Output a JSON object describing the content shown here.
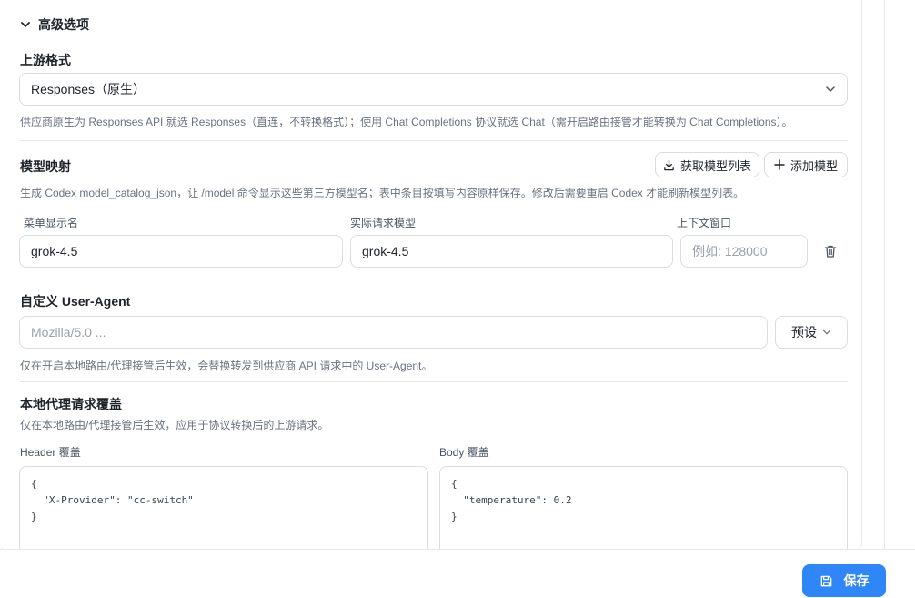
{
  "advanced": {
    "title": "高级选项"
  },
  "upstream_format": {
    "label": "上游格式",
    "value": "Responses（原生）",
    "hint": "供应商原生为 Responses API 就选 Responses（直连，不转换格式）；使用 Chat Completions 协议就选 Chat（需开启路由接管才能转换为 Chat Completions）。"
  },
  "model_mapping": {
    "label": "模型映射",
    "fetch_button": "获取模型列表",
    "add_button": "添加模型",
    "hint": "生成 Codex model_catalog_json，让 /model 命令显示这些第三方模型名；表中条目按填写内容原样保存。修改后需要重启 Codex 才能刷新模型列表。",
    "columns": [
      "菜单显示名",
      "实际请求模型",
      "上下文窗口"
    ],
    "rows": [
      {
        "display_name": "grok-4.5",
        "request_model": "grok-4.5",
        "context_window_placeholder": "例如: 128000"
      }
    ]
  },
  "user_agent": {
    "label": "自定义 User-Agent",
    "placeholder": "Mozilla/5.0 ...",
    "preset_button": "预设",
    "hint": "仅在开启本地路由/代理接管后生效，会替换转发到供应商 API 请求中的 User-Agent。"
  },
  "override": {
    "label": "本地代理请求覆盖",
    "hint": "仅在本地路由/代理接管后生效，应用于协议转换后的上游请求。",
    "header_label": "Header 覆盖",
    "header_value": "{\n  \"X-Provider\": \"cc-switch\"\n}",
    "body_label": "Body 覆盖",
    "body_value": "{\n  \"temperature\": 0.2\n}"
  },
  "footer": {
    "save_label": "保存"
  },
  "colors": {
    "accent": "#2f86f6",
    "border": "#d9dce1",
    "hint_text": "#6b7280"
  }
}
